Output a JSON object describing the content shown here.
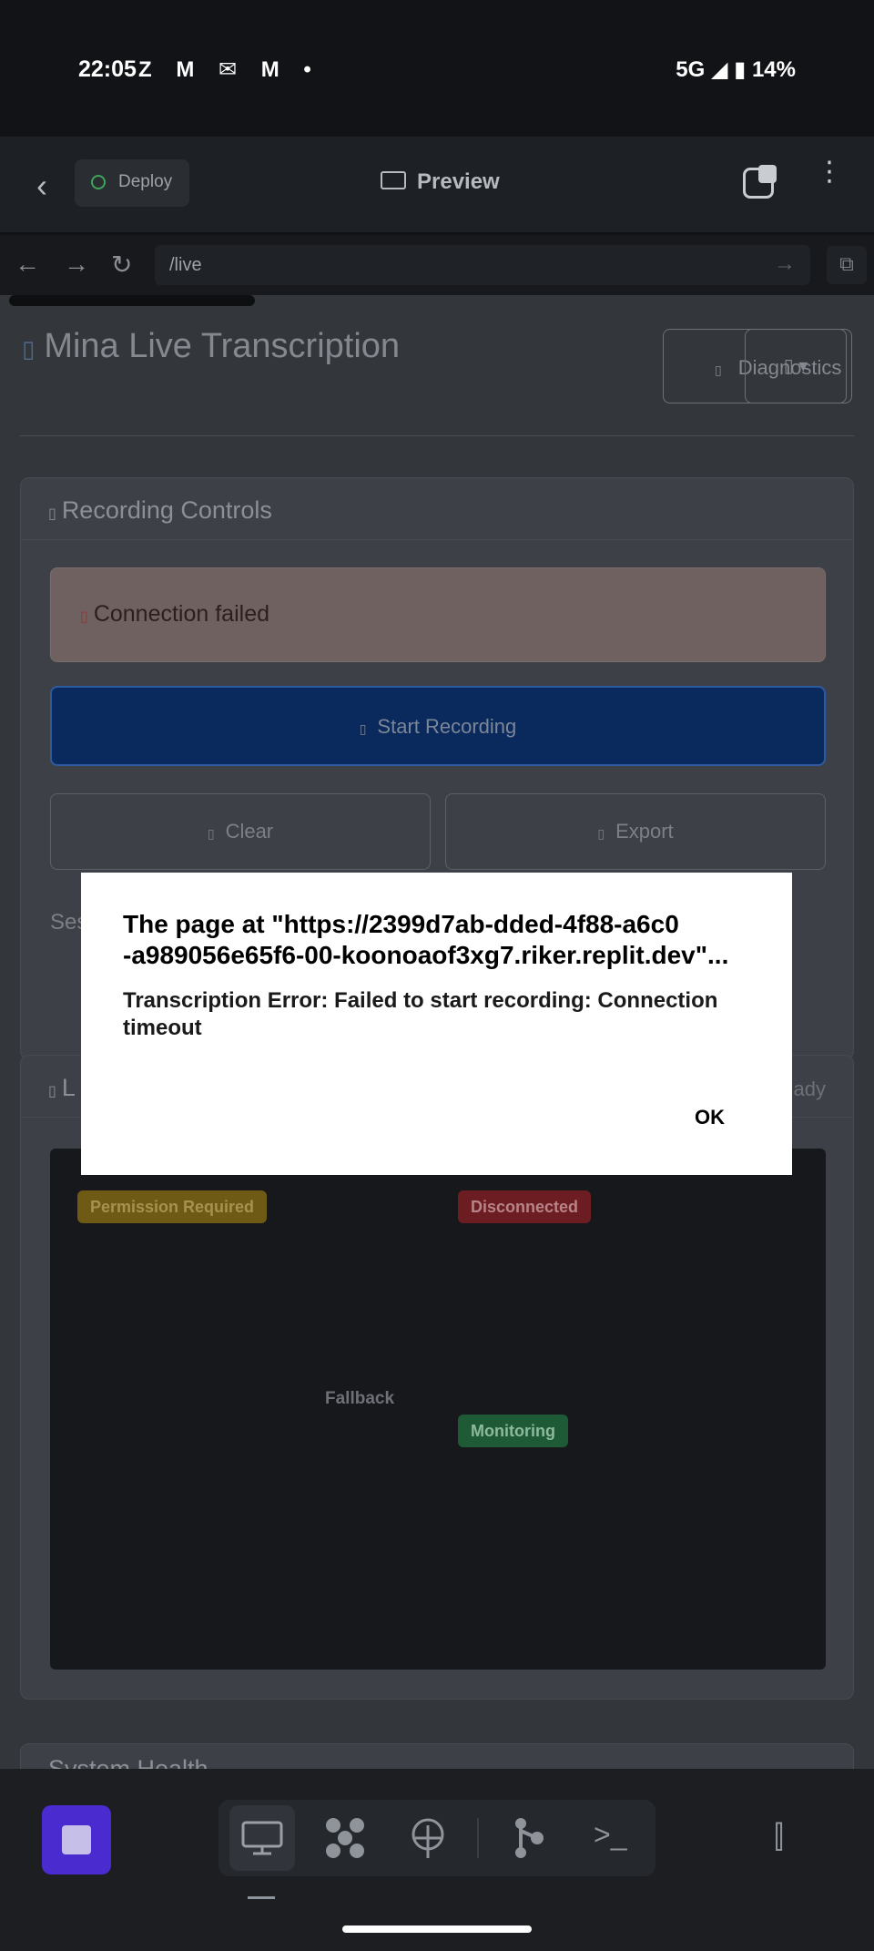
{
  "status_bar": {
    "time": "22:05",
    "notification_icons": "Z M ✉ M •",
    "network": "5G ◢",
    "battery": "14%"
  },
  "app_header": {
    "back_glyph": "‹",
    "deploy_label": "Deploy",
    "preview_label": "Preview",
    "more_glyph": "⋮"
  },
  "url_bar": {
    "back_glyph": "←",
    "forward_glyph": "→",
    "reload_glyph": "↻",
    "url": "/live",
    "go_glyph": "→",
    "open_external_glyph": "⧉"
  },
  "page": {
    "title": "Mina Live Transcription",
    "title_icon_glyph": "▯",
    "diagnostics_label": "Diagnostics",
    "diagnostics_icon_glyph": "▯",
    "diagnostics_caret": "▯ ▾",
    "recording_card": {
      "title": "Recording Controls",
      "title_icon_glyph": "▯",
      "alert_text": "Connection failed",
      "alert_icon_glyph": "▯",
      "start_label": "Start Recording",
      "start_icon_glyph": "▯",
      "clear_label": "Clear",
      "clear_icon_glyph": "▯",
      "export_label": "Export",
      "export_icon_glyph": "▯",
      "session_label": "Ses"
    },
    "live_card": {
      "title": "L",
      "title_icon_glyph": "▯",
      "status_text": "ady",
      "badges": {
        "permission": "Permission Required",
        "connection": "Disconnected",
        "fallback": "Fallback",
        "monitoring": "Monitoring"
      }
    },
    "system_card": {
      "title": "System Health"
    }
  },
  "dialog": {
    "title": "The page at \"https://2399d7ab-dded-4f88-a6c0\n-a989056e65f6-00-koonoaof3xg7.riker.replit.dev\"...",
    "message": "Transcription Error: Failed to start recording: Connection timeout",
    "ok_label": "OK"
  },
  "bottom_bar": {
    "tools": [
      "desktop-icon",
      "apps-icon",
      "signal-icon",
      "git-icon",
      "terminal-icon"
    ],
    "terminal_glyph": ">_",
    "panel_glyph": "⫿"
  },
  "colors": {
    "dialog_bg": "#ffffff",
    "start_button": "#0a2a5e",
    "stop_button": "#4a2bd0",
    "permission_badge": "#6e5a14",
    "disconnected_badge": "#6b1d22",
    "monitoring_badge": "#1f5a36"
  }
}
